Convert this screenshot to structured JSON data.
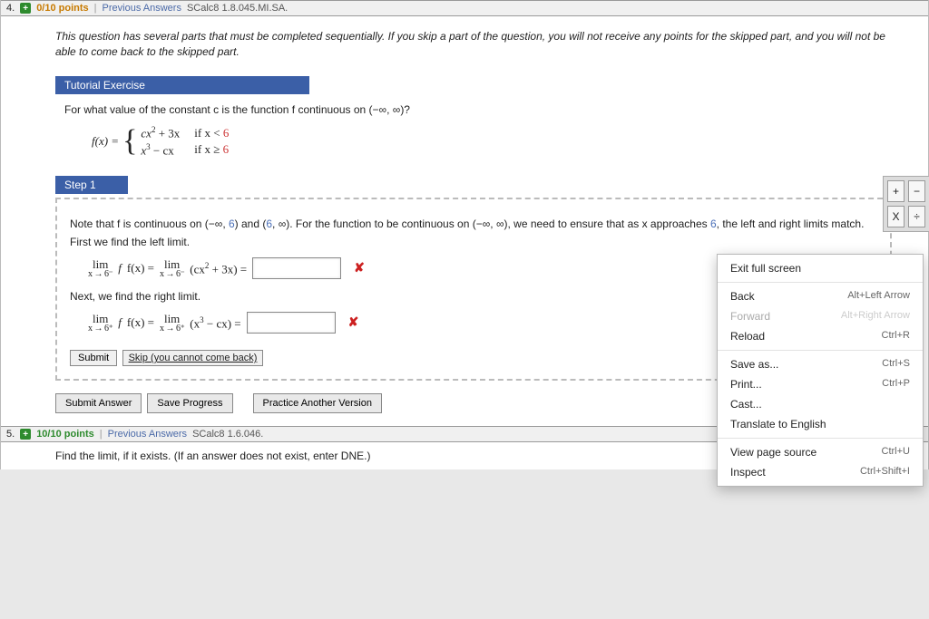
{
  "q4": {
    "number": "4.",
    "points": "0/10 points",
    "previous": "Previous Answers",
    "source": "SCalc8 1.8.045.MI.SA.",
    "warning": "This question has several parts that must be completed sequentially. If you skip a part of the question, you will not receive any points for the skipped part, and you will not be able to come back to the skipped part.",
    "tutorial_header": "Tutorial Exercise",
    "prompt": "For what value of the constant c is the function f continuous on (−∞, ∞)?",
    "fx_label": "f(x) =",
    "piece1_expr_a": "cx",
    "piece1_sup": "2",
    "piece1_expr_b": " + 3x",
    "piece2_expr_a": "x",
    "piece2_sup": "3",
    "piece2_expr_b": " − cx",
    "cond1_a": "if x < ",
    "cond1_b": "6",
    "cond2_a": "if x ≥ ",
    "cond2_b": "6",
    "step_header": "Step 1",
    "step_text_a": "Note that f is continuous on (−∞, ",
    "step_text_b": ") and (",
    "step_text_c": ", ∞). For the function to be continuous on (−∞, ∞), we need to ensure that as x approaches ",
    "step_text_d": ", the left and right limits match.",
    "six": "6",
    "left_intro": "First we find the left limit.",
    "left_lim_label": "lim",
    "left_lim_under": "x → 6⁻",
    "left_eq_fx": "f(x) = ",
    "left_expr_a": "(cx",
    "left_expr_b": " + 3x) = ",
    "right_intro": "Next, we find the right limit.",
    "right_lim_under": "x → 6⁺",
    "right_expr_a": "(x",
    "right_expr_b": " − cx) = ",
    "submit": "Submit",
    "skip": "Skip (you cannot come back)",
    "submit_answer": "Submit Answer",
    "save_progress": "Save Progress",
    "practice": "Practice Another Version"
  },
  "q5": {
    "number": "5.",
    "points": "10/10 points",
    "previous": "Previous Answers",
    "source": "SCalc8 1.6.046.",
    "prompt": "Find the limit, if it exists. (If an answer does not exist, enter DNE.)"
  },
  "ctx": {
    "exit": "Exit full screen",
    "back": "Back",
    "back_s": "Alt+Left Arrow",
    "forward": "Forward",
    "forward_s": "Alt+Right Arrow",
    "reload": "Reload",
    "reload_s": "Ctrl+R",
    "save": "Save as...",
    "save_s": "Ctrl+S",
    "print": "Print...",
    "print_s": "Ctrl+P",
    "cast": "Cast...",
    "translate": "Translate to English",
    "source": "View page source",
    "source_s": "Ctrl+U",
    "inspect": "Inspect",
    "inspect_s": "Ctrl+Shift+I"
  },
  "calc": {
    "plus": "+",
    "minus": "−",
    "x": "X",
    "div": "÷"
  }
}
